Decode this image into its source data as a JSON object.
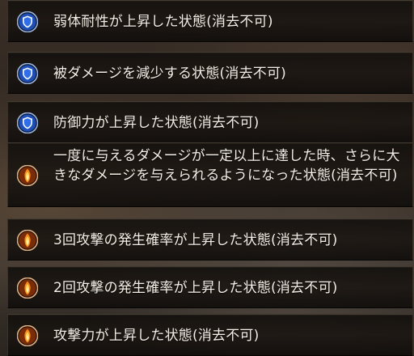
{
  "statuses": [
    {
      "icon": "shield-icon",
      "text": "弱体耐性が上昇した状態(消去不可)"
    },
    {
      "icon": "shield-icon",
      "text": "被ダメージを減少する状態(消去不可)"
    },
    {
      "icon": "shield-icon",
      "text": "防御力が上昇した状態(消去不可)"
    },
    {
      "icon": "flame-icon",
      "text": "一度に与えるダメージが一定以上に達した時、さらに大きなダメージを与えられるようになった状態(消去不可)"
    },
    {
      "icon": "flame-icon",
      "text": "3回攻撃の発生確率が上昇した状態(消去不可)"
    },
    {
      "icon": "flame-icon",
      "text": "2回攻撃の発生確率が上昇した状態(消去不可)"
    },
    {
      "icon": "flame-icon",
      "text": "攻撃力が上昇した状態(消去不可)"
    }
  ],
  "colors": {
    "shield_blue": "#2f6ee8",
    "flame_orange": "#f08a1e",
    "text": "#f4efe6"
  }
}
